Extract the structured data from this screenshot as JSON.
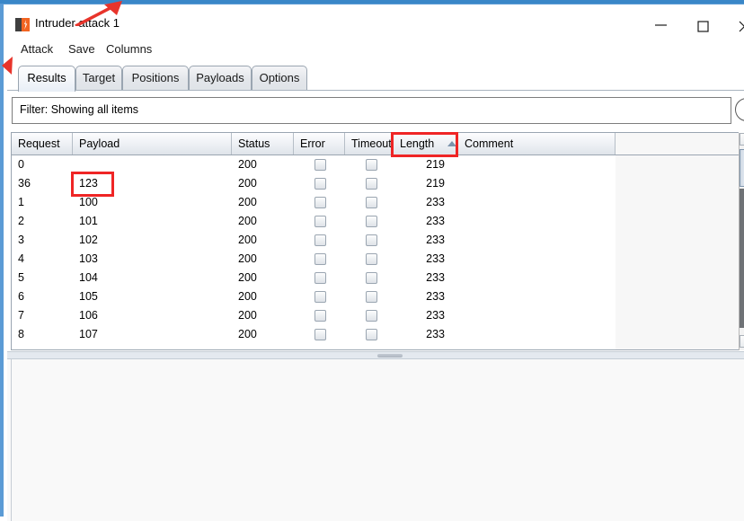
{
  "window": {
    "title": "Intruder attack 1",
    "app_icon": "burp-suite-icon",
    "controls": {
      "minimize": "minimize-icon",
      "maximize": "maximize-icon",
      "close": "close-icon"
    }
  },
  "menu": {
    "items": [
      {
        "label": "Attack"
      },
      {
        "label": "Save"
      },
      {
        "label": "Columns"
      }
    ]
  },
  "tabs": [
    {
      "label": "Results",
      "active": true
    },
    {
      "label": "Target",
      "active": false
    },
    {
      "label": "Positions",
      "active": false
    },
    {
      "label": "Payloads",
      "active": false
    },
    {
      "label": "Options",
      "active": false
    }
  ],
  "filter": {
    "label": "Filter: Showing all items",
    "help_icon": "clock-help-icon"
  },
  "table": {
    "columns": [
      {
        "key": "request",
        "label": "Request"
      },
      {
        "key": "payload",
        "label": "Payload"
      },
      {
        "key": "status",
        "label": "Status"
      },
      {
        "key": "error",
        "label": "Error"
      },
      {
        "key": "timeout",
        "label": "Timeout"
      },
      {
        "key": "length",
        "label": "Length"
      },
      {
        "key": "comment",
        "label": "Comment"
      }
    ],
    "sort": {
      "column": "Length",
      "direction": "ascending",
      "icon": "sort-ascending-icon"
    },
    "rows": [
      {
        "request": "0",
        "payload": "",
        "status": "200",
        "error": false,
        "timeout": false,
        "length": "219",
        "comment": ""
      },
      {
        "request": "36",
        "payload": "123",
        "status": "200",
        "error": false,
        "timeout": false,
        "length": "219",
        "comment": ""
      },
      {
        "request": "1",
        "payload": "100",
        "status": "200",
        "error": false,
        "timeout": false,
        "length": "233",
        "comment": ""
      },
      {
        "request": "2",
        "payload": "101",
        "status": "200",
        "error": false,
        "timeout": false,
        "length": "233",
        "comment": ""
      },
      {
        "request": "3",
        "payload": "102",
        "status": "200",
        "error": false,
        "timeout": false,
        "length": "233",
        "comment": ""
      },
      {
        "request": "4",
        "payload": "103",
        "status": "200",
        "error": false,
        "timeout": false,
        "length": "233",
        "comment": ""
      },
      {
        "request": "5",
        "payload": "104",
        "status": "200",
        "error": false,
        "timeout": false,
        "length": "233",
        "comment": ""
      },
      {
        "request": "6",
        "payload": "105",
        "status": "200",
        "error": false,
        "timeout": false,
        "length": "233",
        "comment": ""
      },
      {
        "request": "7",
        "payload": "106",
        "status": "200",
        "error": false,
        "timeout": false,
        "length": "233",
        "comment": ""
      },
      {
        "request": "8",
        "payload": "107",
        "status": "200",
        "error": false,
        "timeout": false,
        "length": "233",
        "comment": ""
      }
    ]
  },
  "annotations": {
    "highlight_color": "#ef2525",
    "boxes": [
      {
        "name": "payload-123-highlight",
        "target": "123"
      },
      {
        "name": "length-header-highlight",
        "target": "Length"
      }
    ],
    "arrows": [
      {
        "name": "top-arrow"
      },
      {
        "name": "left-arrow"
      }
    ]
  },
  "colors": {
    "window_accent": "#3a87c8",
    "tab_border": "#9aa5b1",
    "header_gradient_top": "#fdfdfe",
    "header_gradient_bottom": "#dfe4ea"
  }
}
